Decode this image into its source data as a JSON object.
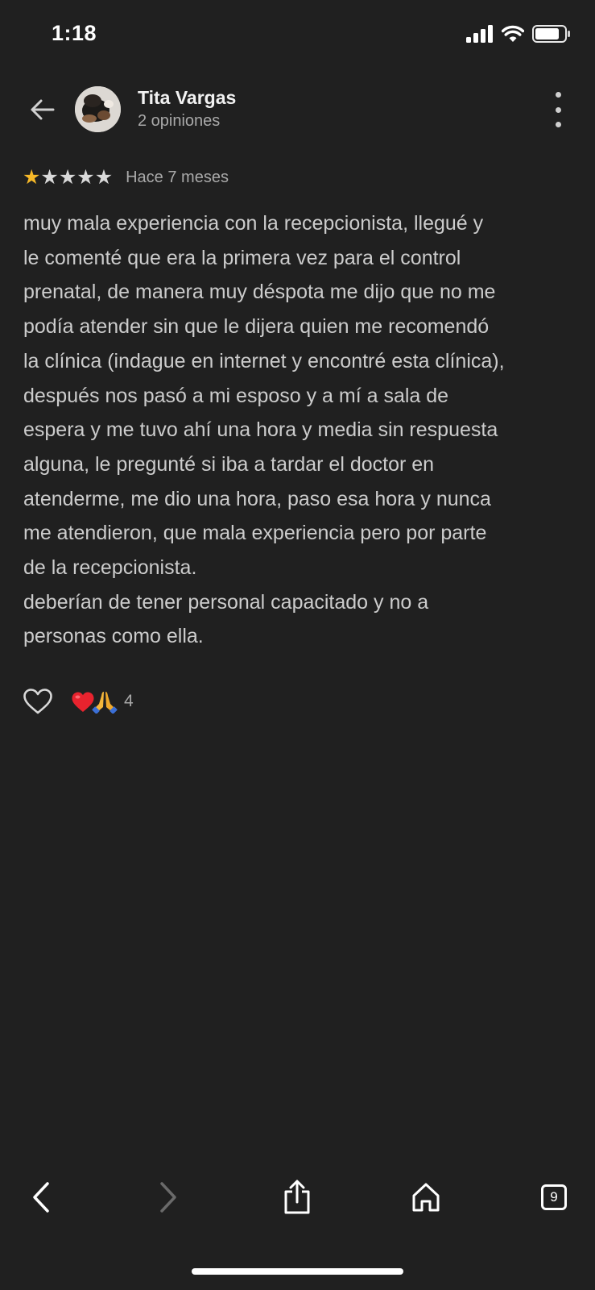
{
  "status_bar": {
    "time": "1:18"
  },
  "header": {
    "reviewer_name": "Tita Vargas",
    "review_count": "2 opiniones",
    "avatar_icon": "avatar-photo"
  },
  "review": {
    "rating": 1,
    "max_rating": 5,
    "time": "Hace 7 meses",
    "text": "muy mala experiencia con la recepcionista, llegué y\nle comenté que era la primera vez para el control\nprenatal, de manera muy déspota me dijo que no me\npodía atender sin que le dijera quien me recomendó\nla clínica (indague en internet y encontré esta clínica),\ndespués nos pasó a mi esposo y a mí a sala de\nespera y me tuvo ahí una hora y media sin respuesta\nalguna, le pregunté si iba a tardar el doctor en\natenderme, me dio una hora, paso esa hora y nunca\nme atendieron, que mala experiencia pero por parte\nde la recepcionista.\ndeberían de tener personal capacitado y no a\npersonas como ella."
  },
  "reactions": {
    "emojis": "❤️🙏",
    "count": "4"
  },
  "toolbar": {
    "tabs_count": "9"
  },
  "colors": {
    "background": "#202020",
    "star_active": "#f7b928",
    "star_inactive": "#d9d9d9",
    "secondary_text": "#a9a9a9"
  }
}
